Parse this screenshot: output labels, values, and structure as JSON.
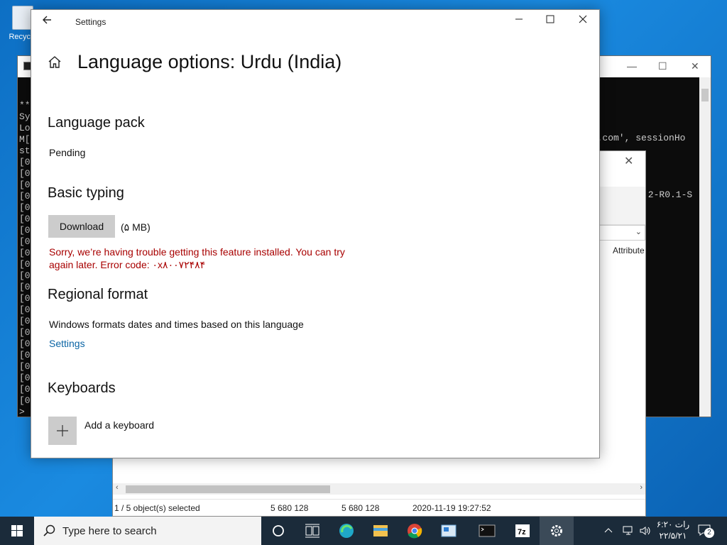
{
  "desktop": {
    "recycle_label": "Recycle"
  },
  "cmd": {
    "left_lines": [
      "***",
      "Sys",
      "Loa",
      "M[0",
      "st-",
      "[08",
      "[08",
      "[08",
      "[08",
      "[08",
      "[08",
      "[08",
      "[08",
      "[08",
      "[08",
      "[08",
      "[08",
      "[08",
      "[08",
      "[08",
      "[08",
      "[08",
      "[08",
      "[08",
      "[08",
      "[08",
      "[08",
      ">"
    ],
    "right_line_1": "ng.com', sessionHo",
    "right_line_2": ".2-R0.1-S"
  },
  "props": {
    "attr_header": "Attribute",
    "status": {
      "selected": "1 / 5 object(s) selected",
      "size": "5 680 128",
      "packed": "5 680 128",
      "modified": "2020-11-19 19:27:52"
    }
  },
  "settings": {
    "window_title": "Settings",
    "page_title": "Language options: Urdu (India)",
    "language_pack": {
      "heading": "Language pack",
      "status": "Pending"
    },
    "basic_typing": {
      "heading": "Basic typing",
      "download_label": "Download",
      "size": "(۵ MB)",
      "error": "Sorry, we’re having trouble getting this feature installed. You can try again later. Error code: ۰x۸۰۰۷۲۴۸۴"
    },
    "regional_format": {
      "heading": "Regional format",
      "description": "Windows formats dates and times based on this language",
      "link": "Settings"
    },
    "keyboards": {
      "heading": "Keyboards",
      "add_label": "Add a keyboard"
    }
  },
  "taskbar": {
    "search_placeholder": "Type here to search",
    "clock_time": "رات ۶:۲۰",
    "clock_date": "۲۲/۵/۲۱",
    "notification_count": "2",
    "icons": [
      "cortana-icon",
      "task-view-icon",
      "edge-icon",
      "file-explorer-icon",
      "chrome-icon",
      "control-panel-icon",
      "cmd-icon",
      "7zip-icon",
      "settings-icon"
    ]
  },
  "colors": {
    "error": "#a80000",
    "link": "#0a64a4",
    "taskbar": "#1b2b3a",
    "desktop": "#1583d8"
  }
}
